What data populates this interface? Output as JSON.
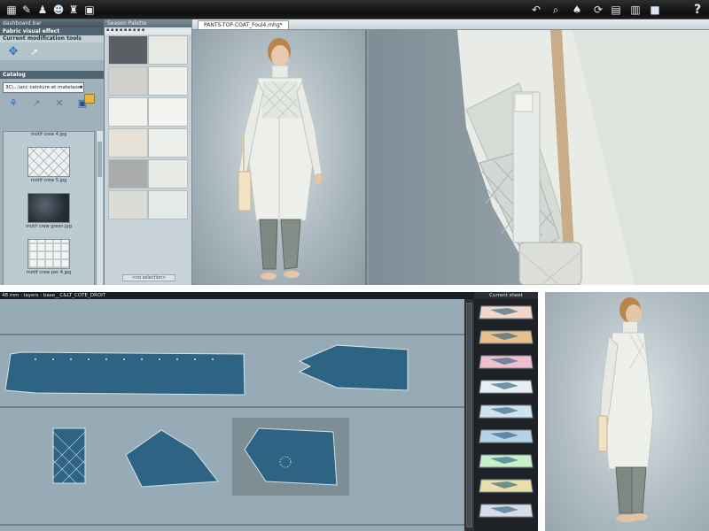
{
  "toolbar": {
    "left_icons": [
      "table-icon",
      "pencil-icon",
      "person-icon",
      "figure-icon",
      "model-icon",
      "window-icon"
    ],
    "right_icons": [
      "back-icon",
      "search-icon",
      "bottle-icon",
      "refresh-icon",
      "sheet-icon",
      "fill-icon",
      "stop-icon"
    ],
    "help_label": "?"
  },
  "dashboard": {
    "header": "dashboard bar",
    "section_title": "Fabric visual effect",
    "subsection": "Current modification tools",
    "catalog_title": "Catalog",
    "catalog_value": "3C\\...\\acc ceinture et matelassé",
    "thumbnails": [
      {
        "label_above": "motif crew 4.jpg",
        "label": "motif crew 5.jpg",
        "style": "quilt"
      },
      {
        "label_above": "",
        "label": "motif crew green.jpg",
        "style": "dark"
      },
      {
        "label_above": "",
        "label": "motif crew per 4.jpg",
        "style": "puff"
      }
    ]
  },
  "palette": {
    "header": "Season Palette",
    "footer": "<no selection>",
    "swatches": [
      "#5b5f63",
      "#e8e9e2",
      "#d2d0cb",
      "#f0f0ea",
      "#f2f1ec",
      "#f3f4ef",
      "#e6e2d8",
      "#eceee9",
      "#a9aca9",
      "#e9ece6",
      "#dcdcd6",
      "#e4ebe6"
    ]
  },
  "viewer": {
    "tab_label": "PANTS-TOP-COAT_Foul4.mhg*"
  },
  "pattern": {
    "header": "48 mm : layers : base__C&LT_COTE_DROIT"
  },
  "sheet": {
    "title": "Current sheet",
    "items": 9
  }
}
